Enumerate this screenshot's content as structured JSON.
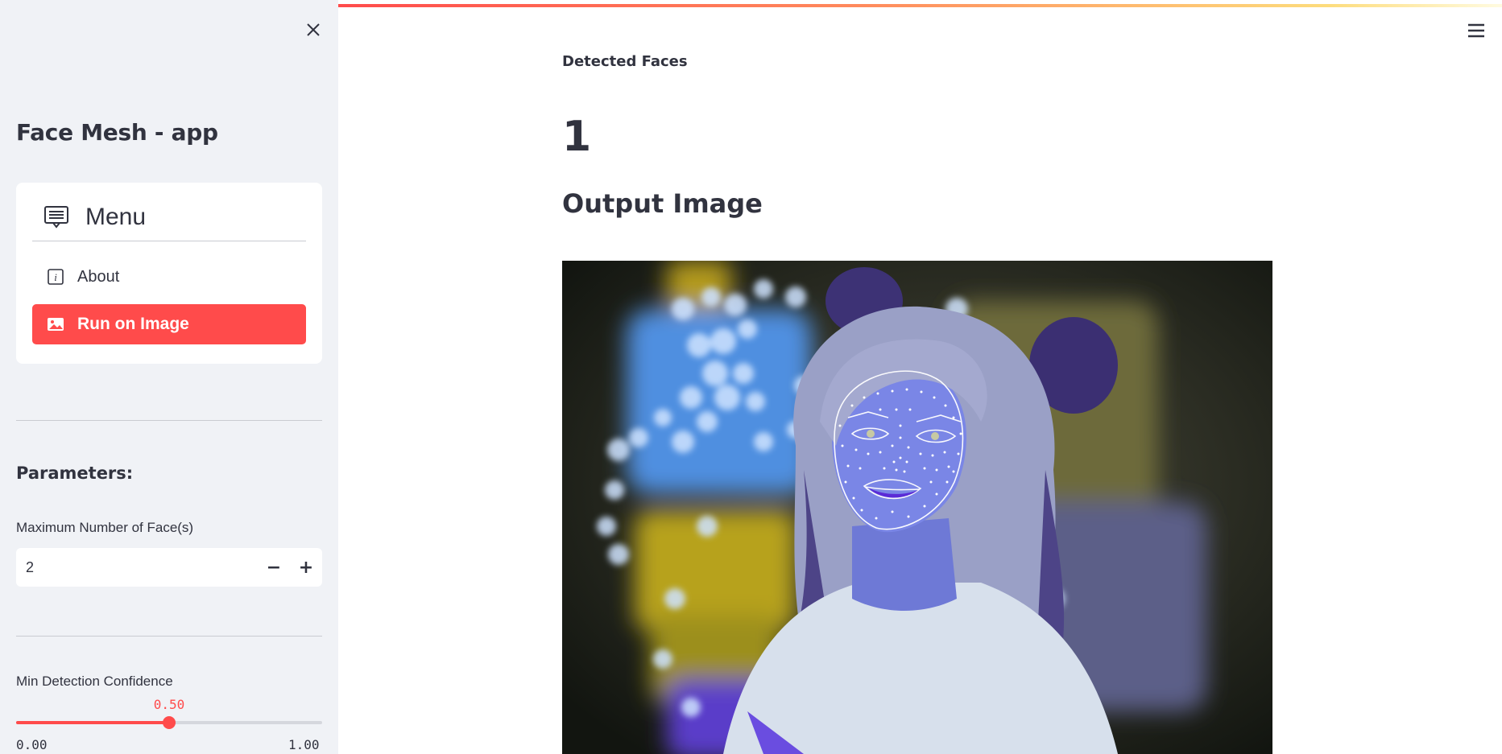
{
  "sidebar": {
    "app_title": "Face Mesh - app",
    "menu": {
      "title": "Menu",
      "items": [
        {
          "label": "About",
          "icon": "info-icon"
        },
        {
          "label": "Run on Image",
          "icon": "image-icon"
        }
      ],
      "selected": "Run on Image"
    },
    "parameters_label": "Parameters:",
    "max_faces": {
      "label": "Maximum Number of Face(s)",
      "value": "2"
    },
    "confidence": {
      "label": "Min Detection Confidence",
      "value": "0.50",
      "value_num": 0.5,
      "min": "0.00",
      "max": "1.00"
    }
  },
  "main": {
    "detected_label": "Detected Faces",
    "detected_value": "1",
    "output_title": "Output Image"
  },
  "colors": {
    "accent": "#ff4b4b",
    "sidebar_bg": "#f0f2f6",
    "text": "#31333f"
  }
}
